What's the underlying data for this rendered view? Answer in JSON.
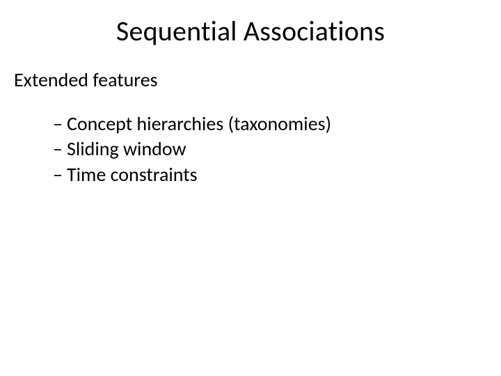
{
  "slide": {
    "title": "Sequential Associations",
    "subtitle": "Extended features",
    "bullets": [
      "Concept hierarchies (taxonomies)",
      "Sliding window",
      "Time constraints"
    ],
    "bullet_marker": "–"
  }
}
